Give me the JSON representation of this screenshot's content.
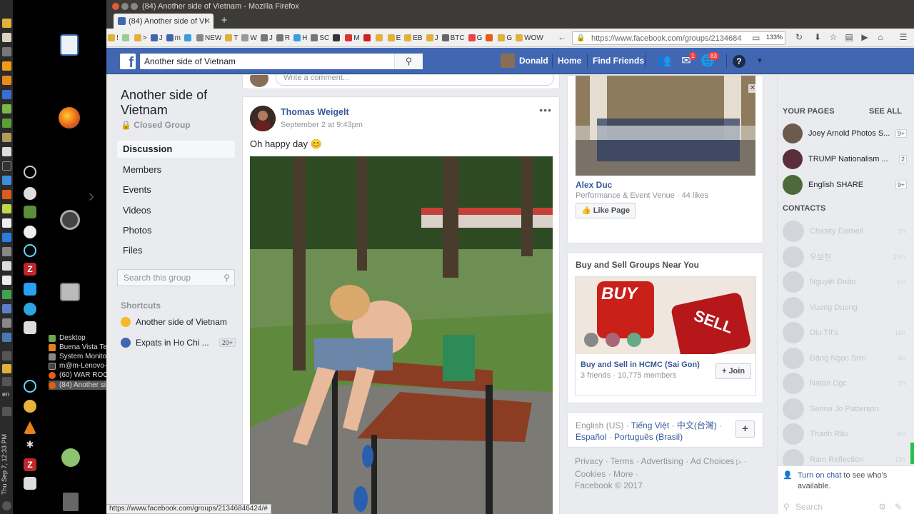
{
  "window_title": "(84) Another side of Vietnam - Mozilla Firefox",
  "tab_title": "(84) Another side of Vi",
  "url": "https://www.facebook.com/groups/2134684",
  "zoom": "133%",
  "bookmarks": [
    "!",
    "",
    ">",
    "J",
    "m",
    "",
    "NEW",
    "T",
    "W",
    "J",
    "R",
    "H",
    "SC",
    "",
    "M",
    "",
    "",
    "E",
    "EB",
    "J",
    "BTC",
    "G",
    "",
    "G",
    "WOW"
  ],
  "taskbar": {
    "items": [
      "Desktop",
      "Buena Vista Te...",
      "System Monitor",
      "m@m-Lenovo-...",
      "(60) WAR ROO...",
      "(84) Another si..."
    ],
    "lang": "en",
    "clock": "Thu Sep 7, 12:33 PM"
  },
  "fb": {
    "search_value": "Another side of Vietnam",
    "user_name": "Donald",
    "nav_home": "Home",
    "nav_find_friends": "Find Friends",
    "messages_badge": "1",
    "notifications_badge": "83"
  },
  "sidebar": {
    "group_name": "Another side of Vietnam",
    "privacy": "Closed Group",
    "nav": [
      "Discussion",
      "Members",
      "Events",
      "Videos",
      "Photos",
      "Files"
    ],
    "search_placeholder": "Search this group",
    "shortcuts_title": "Shortcuts",
    "shortcuts": [
      {
        "label": "Another side of Vietnam",
        "count": ""
      },
      {
        "label": "Expats in Ho Chi ...",
        "count": "20+"
      }
    ]
  },
  "comment_placeholder": "Write a comment...",
  "post": {
    "author": "Thomas Weigelt",
    "time": "September 2 at 9:43pm",
    "text": "Oh happy day 😊"
  },
  "page_suggestion": {
    "name": "Alex Duc",
    "meta": "Performance & Event Venue · 44 likes",
    "like_label": "Like Page"
  },
  "buy_sell": {
    "title": "Buy and Sell Groups Near You",
    "img_buy": "BUY",
    "img_sell": "SELL",
    "group_name": "Buy and Sell in HCMC (Sai Gon)",
    "meta": "3 friends · 10,775 members",
    "join_label": "Join"
  },
  "languages": [
    "English (US)",
    "Tiếng Việt",
    "中文(台灣)",
    "Español",
    "Português (Brasil)"
  ],
  "footer": [
    "Privacy",
    "Terms",
    "Advertising",
    "Ad Choices",
    "Cookies",
    "More",
    "Facebook © 2017"
  ],
  "chat": {
    "your_pages_title": "YOUR PAGES",
    "see_all": "SEE ALL",
    "pages": [
      {
        "name": "Joey Arnold Photos S...",
        "badge": "9+",
        "color": "#6b5a4e"
      },
      {
        "name": "TRUMP Nationalism ...",
        "badge": "2",
        "color": "#5a2e3a"
      },
      {
        "name": "English SHARE",
        "badge": "9+",
        "color": "#4e6a3a"
      }
    ],
    "contacts_title": "CONTACTS",
    "contacts": [
      {
        "name": "Chasity Darnell",
        "time": "2h"
      },
      {
        "name": "우보현",
        "time": "27m"
      },
      {
        "name": "Nguyệt Đoàn",
        "time": "1m"
      },
      {
        "name": "Vuong Duong",
        "time": ""
      },
      {
        "name": "Dịu Tít's",
        "time": "16h"
      },
      {
        "name": "Đặng Ngọc Sơn",
        "time": "4h"
      },
      {
        "name": "Natan Dgc",
        "time": "2h"
      },
      {
        "name": "Serina Jo Patterson",
        "time": ""
      },
      {
        "name": "Thành Râu",
        "time": "6m"
      },
      {
        "name": "Ram Reflection",
        "time": "12h"
      }
    ],
    "turn_on_link": "Turn on chat",
    "turn_on_rest": " to see who's available.",
    "search_placeholder": "Search"
  },
  "status_url": "https://www.facebook.com/groups/21346846424/#"
}
